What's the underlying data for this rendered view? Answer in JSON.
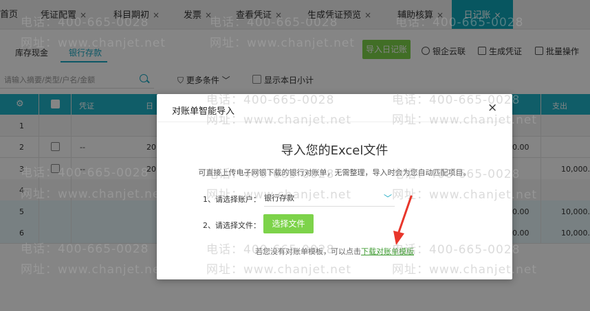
{
  "tabs": [
    {
      "label": "首页",
      "closable": false
    },
    {
      "label": "凭证配置",
      "closable": true
    },
    {
      "label": "科目期初",
      "closable": true
    },
    {
      "label": "发票",
      "closable": true
    },
    {
      "label": "查看凭证",
      "closable": true
    },
    {
      "label": "生成凭证预览",
      "closable": true
    },
    {
      "label": "辅助核算",
      "closable": true
    },
    {
      "label": "日记账",
      "closable": true,
      "active": true
    }
  ],
  "close_glyph": "×",
  "subtabs": [
    "库存现金",
    "银行存款"
  ],
  "active_subtab": "银行存款",
  "toolbar": {
    "import_label": "导入日记账",
    "bank_cloud_label": "银企云联",
    "generate_voucher_label": "生成凭证",
    "batch_label": "批量操作"
  },
  "search": {
    "placeholder": "请输入摘要/类型/户名/金额"
  },
  "filter_label": "更多条件",
  "show_today_label": "显示本日小计",
  "table": {
    "headers": {
      "voucher": "凭证",
      "date_partial": "日",
      "expense": "支出"
    },
    "rows": [
      {
        "num": "1",
        "voucher": "",
        "date": "",
        "income": "",
        "expense": ""
      },
      {
        "num": "2",
        "voucher": "--",
        "date": "20",
        "income": "00.00",
        "expense": ""
      },
      {
        "num": "3",
        "voucher": "--",
        "date": "20",
        "income": "",
        "expense": "10,000."
      },
      {
        "num": "4",
        "voucher": "",
        "date": "",
        "income": "",
        "expense": ""
      },
      {
        "num": "5",
        "voucher": "",
        "date": "",
        "income": "00.00",
        "expense": "10,000."
      },
      {
        "num": "6",
        "voucher": "",
        "date": "",
        "income": "00.00",
        "expense": "10,000."
      }
    ]
  },
  "dialog": {
    "title": "对账单智能导入",
    "close": "×",
    "heading": "导入您的Excel文件",
    "description": "可直接上传电子网银下载的银行对账单，无需整理，导入时会为您自动匹配项目。",
    "step1_label": "1、请选择账户：",
    "account_value": "银行存款",
    "step2_label": "2、请选择文件：",
    "choose_file_label": "选择文件",
    "hint_text": "若您没有对账单模板，可以点击",
    "hint_link": "下载对账单模版"
  },
  "watermark": {
    "phone": "电话：400-665-0028",
    "site": "网址：www.chanjet.net"
  },
  "colors": {
    "accent": "#1fb3c8",
    "green": "#7dd34a",
    "arrow": "#e8362b",
    "link": "#3c9a2f"
  }
}
